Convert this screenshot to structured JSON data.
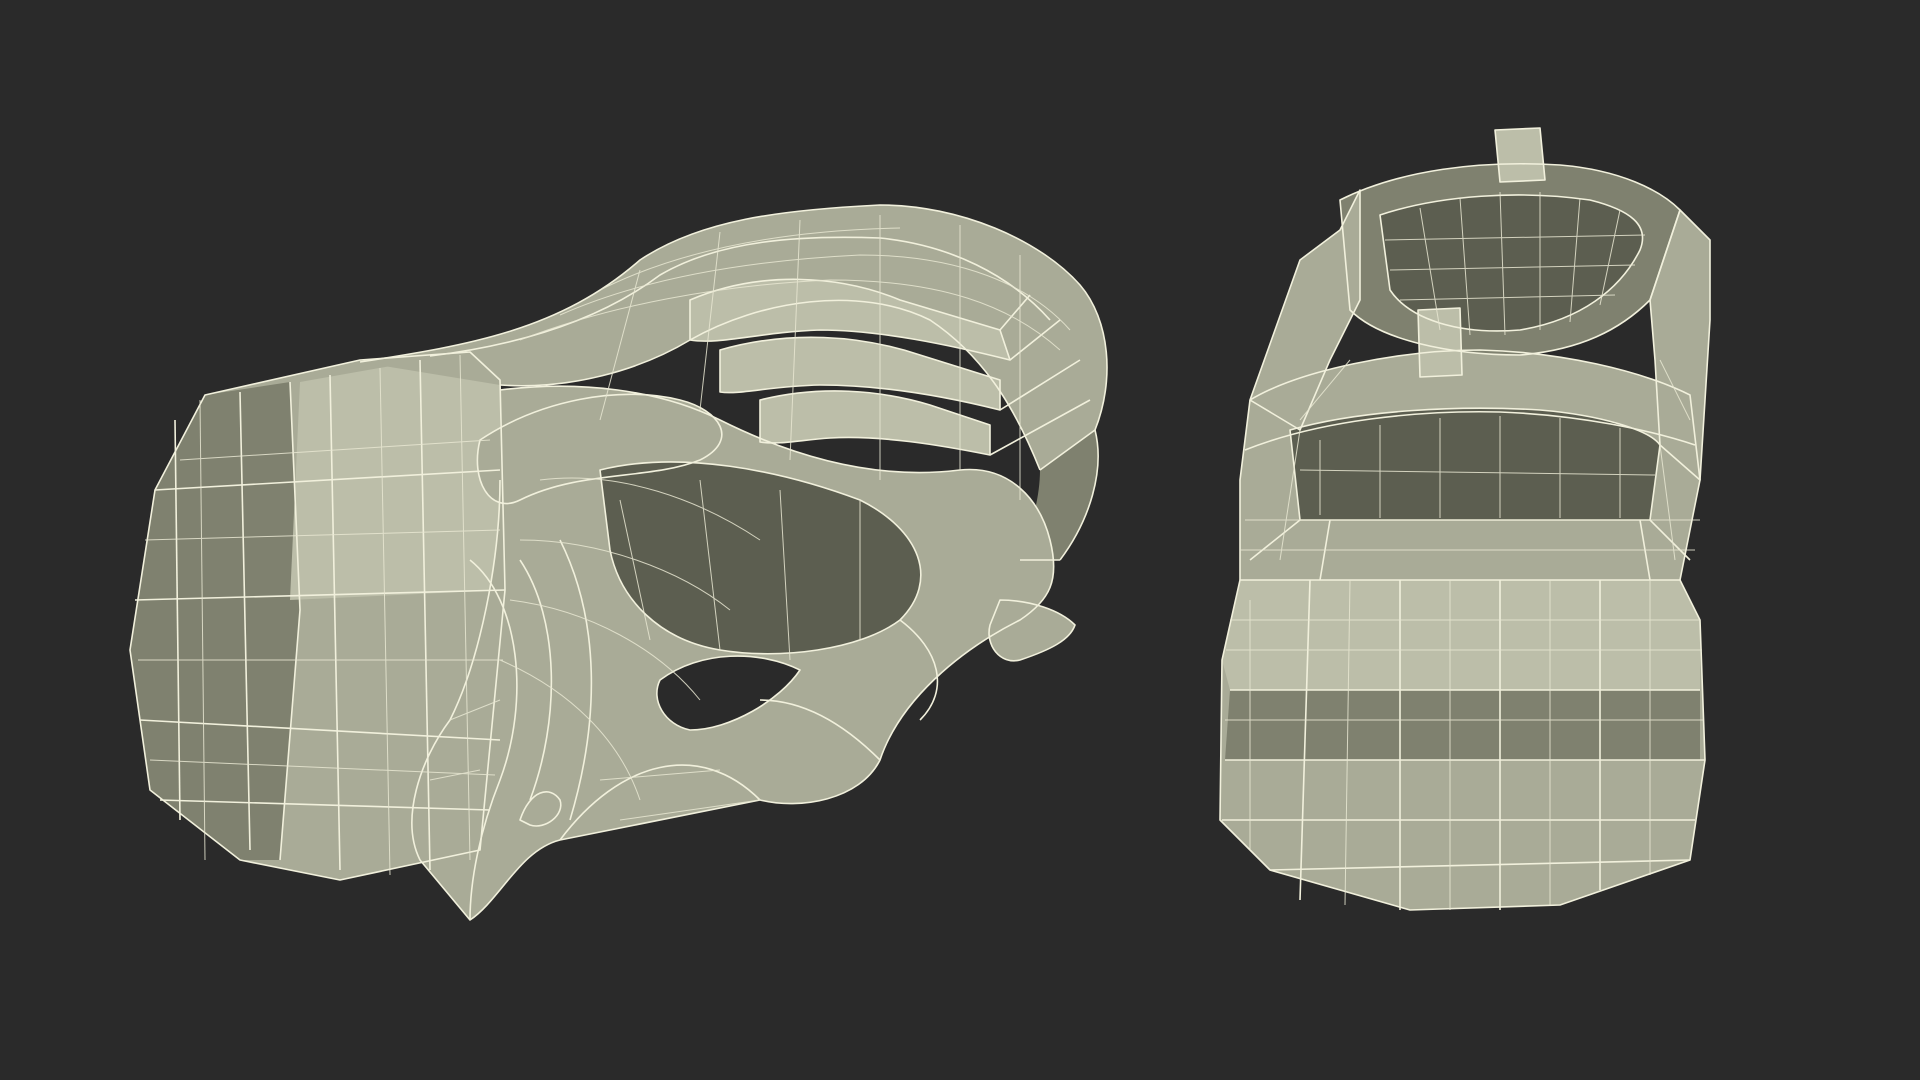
{
  "scene": {
    "background": "#2a2a2a",
    "models": [
      {
        "name": "shoe-side-view",
        "view": "side",
        "shade": "#a9ab97",
        "wire_color": "#f1f0dc"
      },
      {
        "name": "shoe-back-view",
        "view": "back",
        "shade": "#a9ab97",
        "wire_color": "#f1f0dc"
      }
    ]
  }
}
